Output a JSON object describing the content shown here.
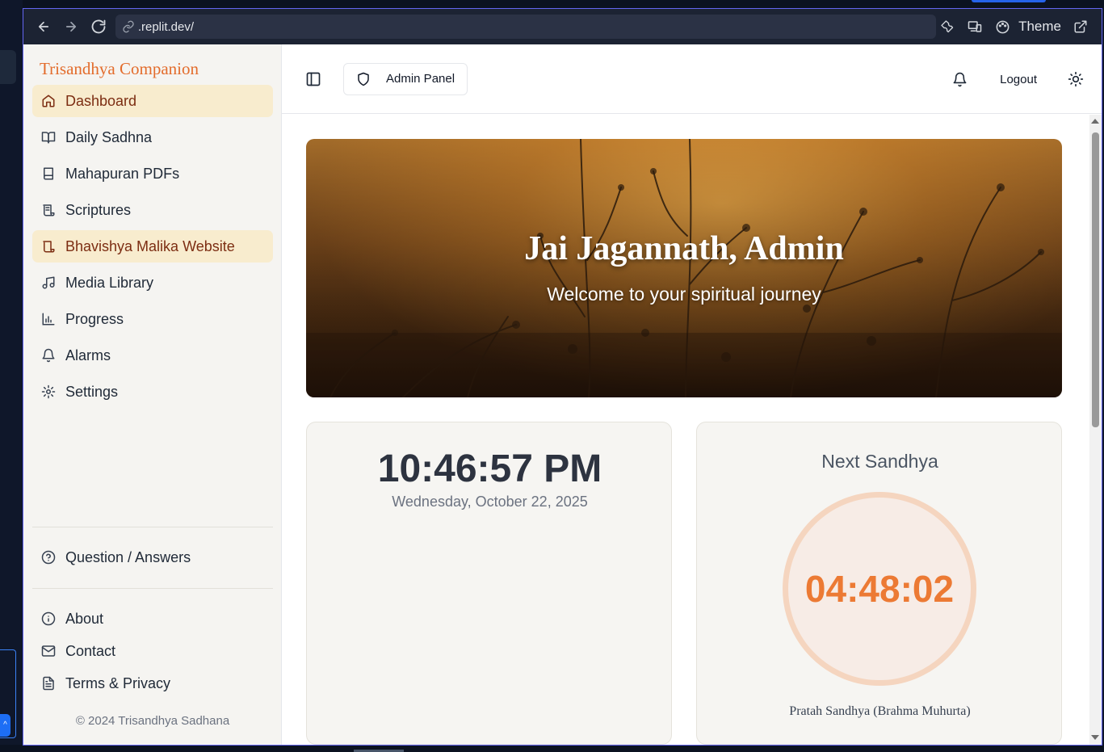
{
  "browser": {
    "url": ".replit.dev/",
    "theme_label": "Theme"
  },
  "sidebar": {
    "brand": "Trisandhya Companion",
    "items": [
      {
        "label": "Dashboard",
        "icon": "home-icon"
      },
      {
        "label": "Daily Sadhna",
        "icon": "book-open-icon"
      },
      {
        "label": "Mahapuran PDFs",
        "icon": "book-icon"
      },
      {
        "label": "Scriptures",
        "icon": "scroll-icon"
      },
      {
        "label": "Bhavishya Malika Website",
        "icon": "scroll-icon"
      },
      {
        "label": "Media Library",
        "icon": "music-icon"
      },
      {
        "label": "Progress",
        "icon": "bar-chart-icon"
      },
      {
        "label": "Alarms",
        "icon": "bell-icon"
      },
      {
        "label": "Settings",
        "icon": "gear-icon"
      }
    ],
    "help_item": {
      "label": "Question / Answers",
      "icon": "help-circle-icon"
    },
    "footer_items": [
      {
        "label": "About",
        "icon": "info-icon"
      },
      {
        "label": "Contact",
        "icon": "mail-icon"
      },
      {
        "label": "Terms & Privacy",
        "icon": "file-text-icon"
      }
    ],
    "copyright": "© 2024 Trisandhya Sadhana"
  },
  "header": {
    "admin_panel_label": "Admin Panel",
    "logout_label": "Logout"
  },
  "hero": {
    "title": "Jai Jagannath, Admin",
    "subtitle": "Welcome to your spiritual journey"
  },
  "clock": {
    "time": "10:46:57 PM",
    "date": "Wednesday, October 22, 2025"
  },
  "next_sandhya": {
    "title": "Next Sandhya",
    "countdown": "04:48:02",
    "name": "Pratah Sandhya (Brahma Muhurta)"
  },
  "colors": {
    "accent": "#e36c2c",
    "active_bg": "#f8ecce",
    "countdown": "#ec7a34"
  }
}
